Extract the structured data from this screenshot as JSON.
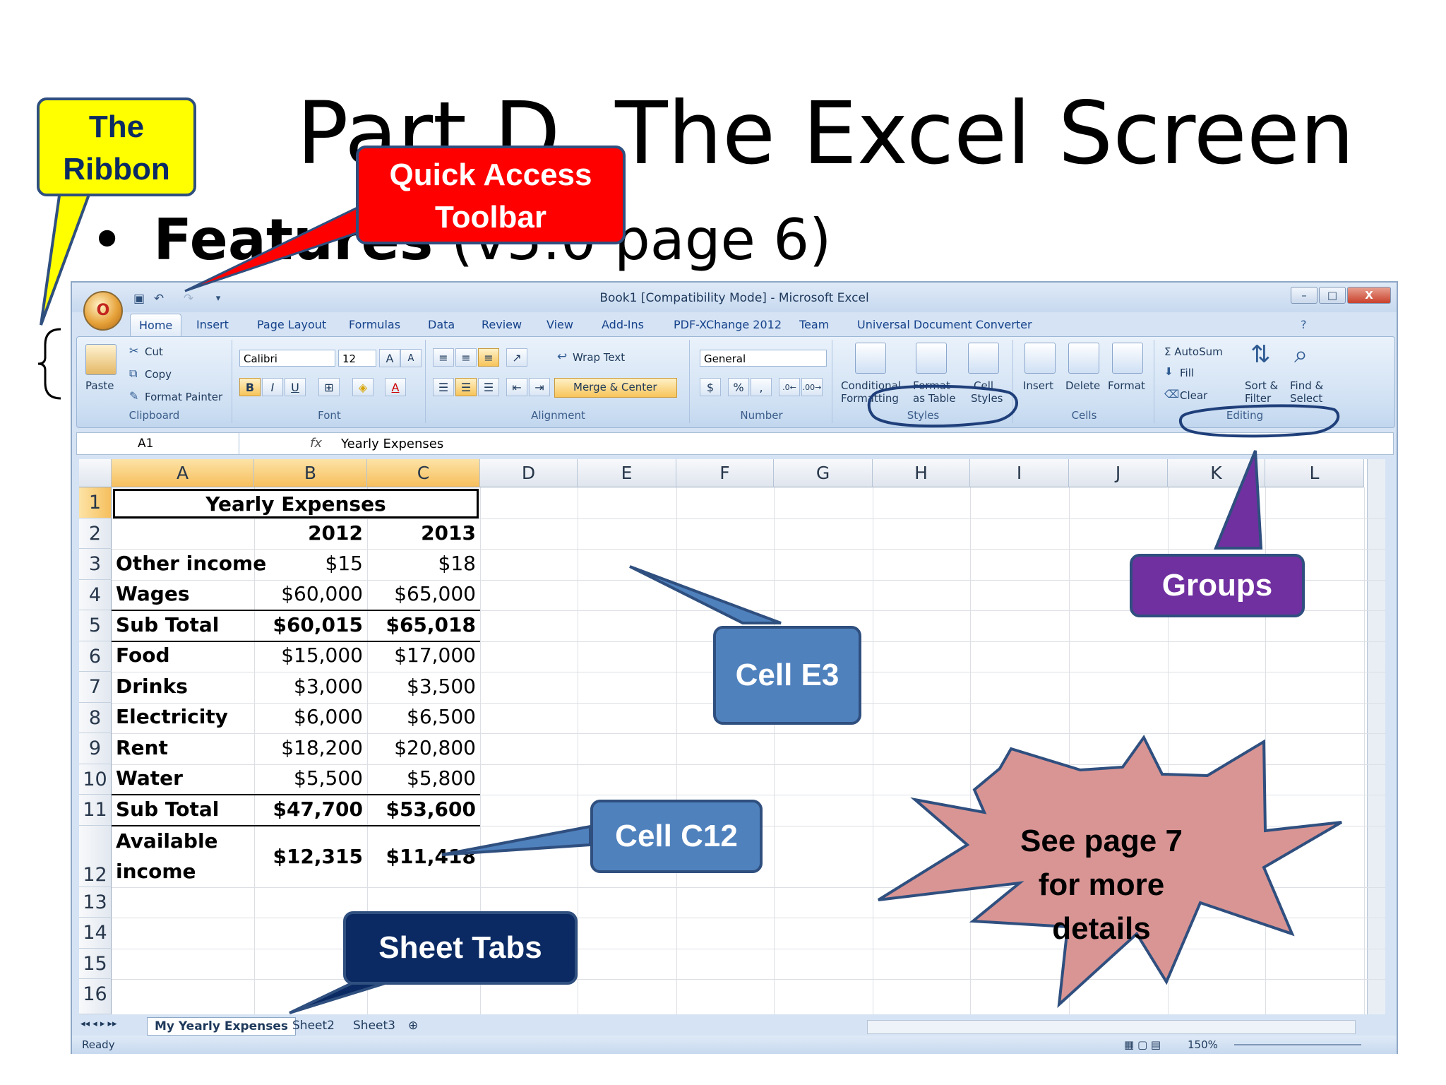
{
  "slide": {
    "title": "Part D. The Excel Screen",
    "bullet": "•",
    "bullet_bold": "Features",
    "bullet_rest": "(v5.0 page 6)"
  },
  "window": {
    "title": "Book1  [Compatibility Mode] - Microsoft Excel",
    "office_button": "O",
    "minimize": "–",
    "restore": "□",
    "close": "X"
  },
  "tabs": [
    "Home",
    "Insert",
    "Page Layout",
    "Formulas",
    "Data",
    "Review",
    "View",
    "Add-Ins",
    "PDF-XChange 2012",
    "Team",
    "Universal Document Converter"
  ],
  "ribbon": {
    "clipboard": {
      "paste": "Paste",
      "cut": "Cut",
      "copy": "Copy",
      "format_painter": "Format Painter",
      "label": "Clipboard"
    },
    "font": {
      "name": "Calibri",
      "size": "12",
      "bold": "B",
      "italic": "I",
      "underline": "U",
      "label": "Font"
    },
    "alignment": {
      "wrap": "Wrap Text",
      "merge": "Merge & Center",
      "label": "Alignment"
    },
    "number": {
      "format": "General",
      "currency": "$",
      "percent": "%",
      "comma": ",",
      "label": "Number"
    },
    "styles": {
      "conditional": "Conditional",
      "formatting": "Formatting",
      "format_table": "Format",
      "as_table": "as Table",
      "cell": "Cell",
      "cell_styles": "Styles",
      "label": "Styles"
    },
    "cells": {
      "insert": "Insert",
      "delete": "Delete",
      "format": "Format",
      "label": "Cells"
    },
    "editing": {
      "autosum": "Σ AutoSum",
      "fill": "Fill",
      "clear": "Clear",
      "sort": "Sort &",
      "filter": "Filter",
      "find": "Find &",
      "select": "Select",
      "label": "Editing"
    }
  },
  "formula_bar": {
    "name_box": "A1",
    "fx": "fx",
    "value": "Yearly Expenses"
  },
  "grid": {
    "columns": [
      "A",
      "B",
      "C",
      "D",
      "E",
      "F",
      "G",
      "H",
      "I",
      "J",
      "K",
      "L"
    ],
    "rows": [
      "1",
      "2",
      "3",
      "4",
      "5",
      "6",
      "7",
      "8",
      "9",
      "10",
      "11",
      "12",
      "13",
      "14",
      "15",
      "16"
    ],
    "title": "Yearly Expenses",
    "year1": "2012",
    "year2": "2013",
    "data": [
      [
        "Other income",
        "$15",
        "$18"
      ],
      [
        "Wages",
        "$60,000",
        "$65,000"
      ],
      [
        "Sub Total",
        "$60,015",
        "$65,018"
      ],
      [
        "Food",
        "$15,000",
        "$17,000"
      ],
      [
        "Drinks",
        "$3,000",
        "$3,500"
      ],
      [
        "Electricity",
        "$6,000",
        "$6,500"
      ],
      [
        "Rent",
        "$18,200",
        "$20,800"
      ],
      [
        "Water",
        "$5,500",
        "$5,800"
      ],
      [
        "Sub Total",
        "$47,700",
        "$53,600"
      ]
    ],
    "available_1": "Available",
    "available_2": "income",
    "avail_b": "$12,315",
    "avail_c": "$11,418"
  },
  "sheet_tabs": [
    "My Yearly Expenses",
    "Sheet2",
    "Sheet3"
  ],
  "status": {
    "ready": "Ready",
    "zoom": "150%"
  },
  "callouts": {
    "ribbon": [
      "The",
      "Ribbon"
    ],
    "qat": [
      "Quick Access",
      "Toolbar"
    ],
    "groups": "Groups",
    "cell_e3": "Cell E3",
    "cell_c12": "Cell C12",
    "sheet_tabs": "Sheet Tabs",
    "see_page": [
      "See page 7",
      "for more",
      "details"
    ]
  },
  "colors": {
    "ribbon_callout": "#ffff00",
    "qat_callout": "#ff0000",
    "groups_callout": "#7030a0",
    "cell_callout": "#4f81bd",
    "sheet_callout": "#0b2a63",
    "star": "#d99594"
  }
}
